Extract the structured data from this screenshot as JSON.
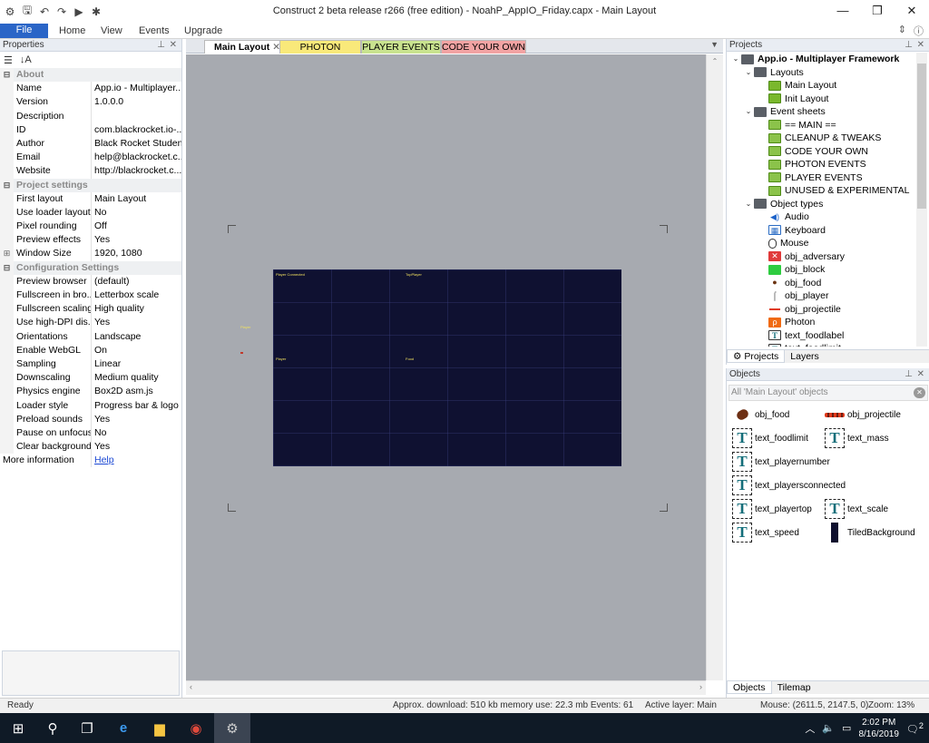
{
  "window": {
    "title": "Construct 2 beta release r266  (free edition) - NoahP_AppIO_Friday.capx - Main Layout",
    "minimize": "—",
    "maximize": "❐",
    "close": "✕"
  },
  "ribbon": {
    "tabs": [
      "File",
      "Home",
      "View",
      "Events",
      "Upgrade"
    ]
  },
  "properties": {
    "title": "Properties",
    "more_info_label": "More information",
    "more_info_link": "Help",
    "sections": [
      {
        "name": "About",
        "rows": [
          [
            "Name",
            "App.io - Multiplayer..."
          ],
          [
            "Version",
            "1.0.0.0"
          ],
          [
            "Description",
            ""
          ],
          [
            "ID",
            "com.blackrocket.io-..."
          ],
          [
            "Author",
            "Black Rocket Students"
          ],
          [
            "Email",
            "help@blackrocket.c..."
          ],
          [
            "Website",
            "http://blackrocket.c..."
          ]
        ]
      },
      {
        "name": "Project settings",
        "rows": [
          [
            "First layout",
            "Main Layout"
          ],
          [
            "Use loader layout",
            "No"
          ],
          [
            "Pixel rounding",
            "Off"
          ],
          [
            "Preview effects",
            "Yes"
          ],
          [
            "Window Size",
            "1920, 1080"
          ]
        ]
      },
      {
        "name": "Configuration Settings",
        "rows": [
          [
            "Preview browser",
            "(default)"
          ],
          [
            "Fullscreen in bro...",
            "Letterbox scale"
          ],
          [
            "Fullscreen scaling",
            "High quality"
          ],
          [
            "Use high-DPI dis...",
            "Yes"
          ],
          [
            "Orientations",
            "Landscape"
          ],
          [
            "Enable WebGL",
            "On"
          ],
          [
            "Sampling",
            "Linear"
          ],
          [
            "Downscaling",
            "Medium quality"
          ],
          [
            "Physics engine",
            "Box2D asm.js"
          ],
          [
            "Loader style",
            "Progress bar & logo"
          ],
          [
            "Preload sounds",
            "Yes"
          ],
          [
            "Pause on unfocus",
            "No"
          ],
          [
            "Clear background",
            "Yes"
          ]
        ]
      }
    ]
  },
  "doc_tabs": [
    "Main Layout",
    "PHOTON EVENTS",
    "PLAYER EVENTS",
    "CODE YOUR OWN"
  ],
  "layout": {
    "canvas_labels": [
      "Player Connected",
      "TopPlayer",
      "Player",
      "Food"
    ],
    "side_label": "Player"
  },
  "projects": {
    "title": "Projects",
    "root": "App.io - Multiplayer Framework",
    "layouts_folder": "Layouts",
    "layouts": [
      "Main Layout",
      "Init Layout"
    ],
    "event_sheets_folder": "Event sheets",
    "event_sheets": [
      "== MAIN ==",
      "CLEANUP & TWEAKS",
      "CODE YOUR OWN",
      "PHOTON EVENTS",
      "PLAYER EVENTS",
      "UNUSED & EXPERIMENTAL"
    ],
    "object_types_folder": "Object types",
    "object_types": [
      {
        "name": "Audio",
        "icon": "speaker-icon"
      },
      {
        "name": "Keyboard",
        "icon": "keyboard-icon"
      },
      {
        "name": "Mouse",
        "icon": "mouse-icon"
      },
      {
        "name": "obj_adversary",
        "icon": "adversary-icon"
      },
      {
        "name": "obj_block",
        "icon": "block-icon"
      },
      {
        "name": "obj_food",
        "icon": "food-icon"
      },
      {
        "name": "obj_player",
        "icon": "player-icon"
      },
      {
        "name": "obj_projectile",
        "icon": "projectile-icon"
      },
      {
        "name": "Photon",
        "icon": "photon-icon"
      },
      {
        "name": "text_foodlabel",
        "icon": "text-icon"
      },
      {
        "name": "text_foodlimit",
        "icon": "text-icon"
      }
    ],
    "tabs": [
      "Projects",
      "Layers"
    ]
  },
  "objects": {
    "title": "Objects",
    "search_placeholder": "All 'Main Layout' objects",
    "items": [
      {
        "name": "obj_food",
        "kind": "food"
      },
      {
        "name": "obj_projectile",
        "kind": "proj"
      },
      {
        "name": "text_foodlimit",
        "kind": "text"
      },
      {
        "name": "text_mass",
        "kind": "text"
      },
      {
        "name": "text_playernumber",
        "kind": "text"
      },
      {
        "name": "text_playersconnected",
        "kind": "text"
      },
      {
        "name": "text_playertop",
        "kind": "text"
      },
      {
        "name": "text_scale",
        "kind": "text"
      },
      {
        "name": "text_speed",
        "kind": "text"
      },
      {
        "name": "TiledBackground",
        "kind": "tiled"
      }
    ],
    "tabs": [
      "Objects",
      "Tilemap"
    ]
  },
  "status": {
    "ready": "Ready",
    "download": "Approx. download: 510 kb  memory use: 22.3 mb  Events: 61",
    "active_layer": "Active layer: Main",
    "mouse": "Mouse: (2611.5, 2147.5, 0)",
    "zoom": "Zoom: 13%"
  },
  "taskbar": {
    "time": "2:02 PM",
    "date": "8/16/2019",
    "notifications": "2"
  },
  "colors": {
    "accent": "#2a65c7",
    "canvas_bg": "#0f1131",
    "tab_yellow": "#f9e97a",
    "tab_green": "#c9e38f",
    "tab_red": "#f2a3a3"
  }
}
